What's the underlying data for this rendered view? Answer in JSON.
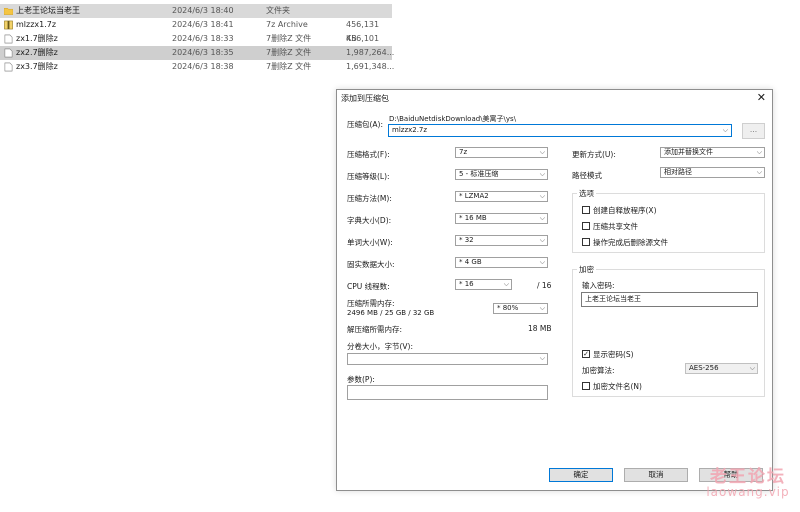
{
  "files": [
    {
      "name": "上老王论坛当老王",
      "date": "2024/6/3 18:40",
      "type": "文件夹",
      "size": "",
      "icon": "folder-icon"
    },
    {
      "name": "mlzzx1.7z",
      "date": "2024/6/3 18:41",
      "type": "7z Archive",
      "size": "456,131 KB",
      "icon": "archive-icon"
    },
    {
      "name": "zx1.7删除z",
      "date": "2024/6/3 18:33",
      "type": "7删除Z 文件",
      "size": "456,101 KB",
      "icon": "file-icon"
    },
    {
      "name": "zx2.7删除z",
      "date": "2024/6/3 18:35",
      "type": "7删除Z 文件",
      "size": "1,987,264...",
      "icon": "file-icon"
    },
    {
      "name": "zx3.7删除z",
      "date": "2024/6/3 18:38",
      "type": "7删除Z 文件",
      "size": "1,691,348...",
      "icon": "file-icon"
    }
  ],
  "dialog": {
    "title": "添加到压缩包",
    "close": "✕",
    "archive_label": "压缩包(A):",
    "archive_path": "D:\\BaiduNetdiskDownload\\美寓子\\ys\\",
    "archive_name": "mlzzx2.7z",
    "browse": "...",
    "format_label": "压缩格式(F):",
    "format_value": "7z",
    "level_label": "压缩等级(L):",
    "level_value": "5 - 标准压缩",
    "method_label": "压缩方法(M):",
    "method_value": "* LZMA2",
    "dict_label": "字典大小(D):",
    "dict_value": "* 16 MB",
    "word_label": "单词大小(W):",
    "word_value": "* 32",
    "solid_label": "固实数据大小:",
    "solid_value": "* 4 GB",
    "cpu_label": "CPU 线程数:",
    "cpu_value": "* 16",
    "cpu_total": "/ 16",
    "mem_label": "压缩所需内存:",
    "mem_detail": "2496 MB / 25 GB / 32 GB",
    "mem_value": "* 80%",
    "decomp_label": "解压缩所需内存:",
    "decomp_value": "18 MB",
    "split_label": "分卷大小，字节(V):",
    "split_value": "",
    "params_label": "参数(P):",
    "params_value": "",
    "update_label": "更新方式(U):",
    "update_value": "添加并替换文件",
    "path_label": "路径模式",
    "path_value": "相对路径",
    "options_title": "选项",
    "opt_sfx": "创建自释放程序(X)",
    "opt_shared": "压缩共享文件",
    "opt_delete": "操作完成后删除源文件",
    "encryption_title": "加密",
    "password_label": "输入密码:",
    "password_value": "上老王论坛当老王",
    "show_password": "显示密码(S)",
    "enc_method_label": "加密算法:",
    "enc_method_value": "AES-256",
    "encrypt_names": "加密文件名(N)",
    "ok": "确定",
    "cancel": "取消",
    "help": "帮助"
  },
  "watermark": {
    "line1": "老王论坛",
    "line2": "laowang.vip"
  }
}
